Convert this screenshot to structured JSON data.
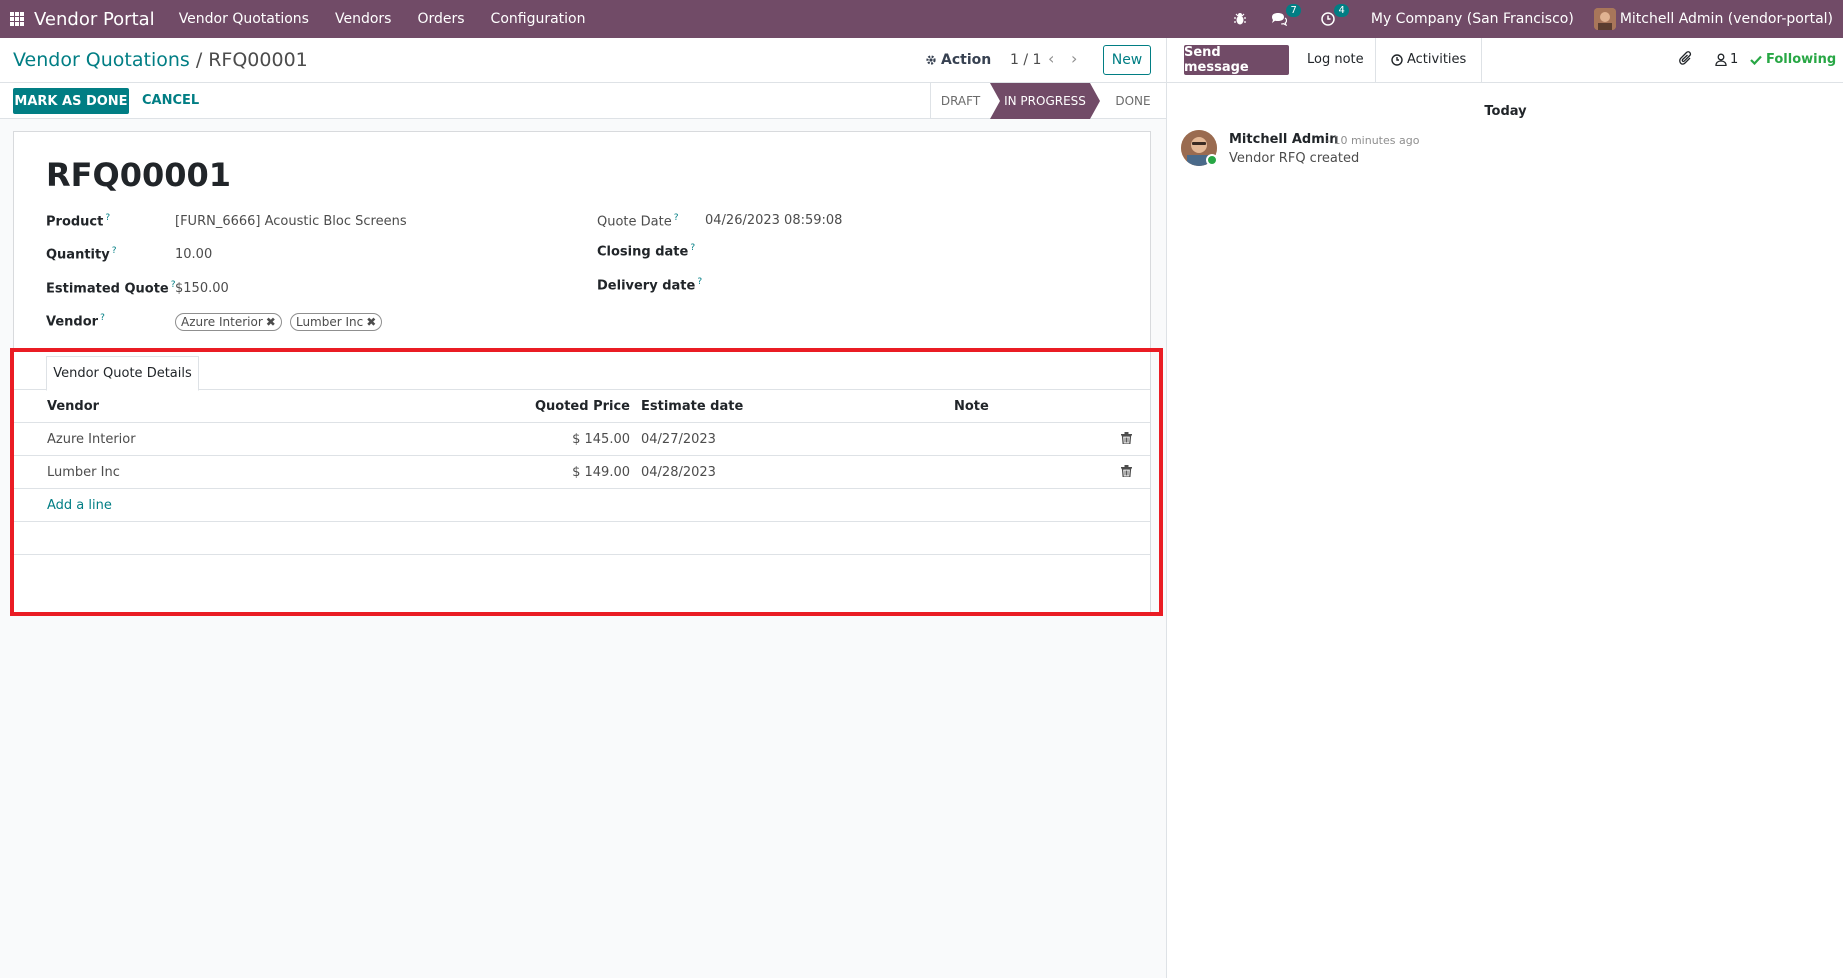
{
  "navbar": {
    "brand": "Vendor Portal",
    "menu": [
      "Vendor Quotations",
      "Vendors",
      "Orders",
      "Configuration"
    ],
    "messages_count": "7",
    "activities_count": "4",
    "company": "My Company (San Francisco)",
    "user": "Mitchell Admin (vendor-portal)"
  },
  "control": {
    "breadcrumb_parent": "Vendor Quotations",
    "breadcrumb_sep": "/",
    "breadcrumb_current": "RFQ00001",
    "action_label": "Action",
    "pager": "1 / 1",
    "new_label": "New"
  },
  "status": {
    "mark_done_label": "MARK AS DONE",
    "cancel_label": "CANCEL",
    "stages": [
      "DRAFT",
      "IN PROGRESS",
      "DONE"
    ],
    "active_stage": "IN PROGRESS"
  },
  "form": {
    "title": "RFQ00001",
    "product_label": "Product",
    "product_value": "[FURN_6666] Acoustic Bloc Screens",
    "quantity_label": "Quantity",
    "quantity_value": "10.00",
    "estimated_label": "Estimated Quote",
    "estimated_value": "$150.00",
    "vendor_label": "Vendor",
    "vendor_tags": [
      "Azure Interior",
      "Lumber Inc"
    ],
    "quote_date_label": "Quote Date",
    "quote_date_value": "04/26/2023 08:59:08",
    "closing_date_label": "Closing date",
    "delivery_date_label": "Delivery date",
    "help_mark": "?"
  },
  "tab": {
    "label": "Vendor Quote Details"
  },
  "table": {
    "headers": {
      "vendor": "Vendor",
      "price": "Quoted Price",
      "date": "Estimate date",
      "note": "Note"
    },
    "rows": [
      {
        "vendor": "Azure Interior",
        "price": "$ 145.00",
        "date": "04/27/2023",
        "note": ""
      },
      {
        "vendor": "Lumber Inc",
        "price": "$ 149.00",
        "date": "04/28/2023",
        "note": ""
      }
    ],
    "add_line": "Add a line"
  },
  "chatter": {
    "send_label": "Send message",
    "log_label": "Log note",
    "activities_label": "Activities",
    "followers_count": "1",
    "following_label": "Following",
    "today_label": "Today",
    "message": {
      "author": "Mitchell Admin",
      "time": "- 10 minutes ago",
      "body": "Vendor RFQ created"
    }
  },
  "colors": {
    "brand": "#714b67",
    "accent": "#017e84",
    "highlight": "#ea1c24",
    "following": "#28a745"
  }
}
